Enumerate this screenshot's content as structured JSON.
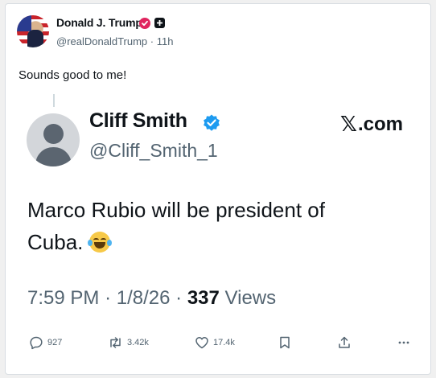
{
  "post": {
    "author_name": "Donald J. Trump",
    "handle": "@realDonaldTrump",
    "separator": "·",
    "time": "11h",
    "text": "Sounds good to me!"
  },
  "quoted": {
    "name": "Cliff Smith",
    "handle": "@Cliff_Smith_1",
    "source": ".com",
    "source_mark": "𝕏",
    "text": "Marco Rubio will be president of Cuba.",
    "time": "7:59 PM",
    "dot1": "·",
    "date": "1/8/26",
    "dot2": "·",
    "views_count": "337",
    "views_label": "Views"
  },
  "actions": {
    "replies": "927",
    "reposts": "3.42k",
    "likes": "17.4k"
  },
  "colors": {
    "verified_pink": "#e0245e",
    "verified_blue": "#1d9bf0",
    "muted": "#536471"
  }
}
